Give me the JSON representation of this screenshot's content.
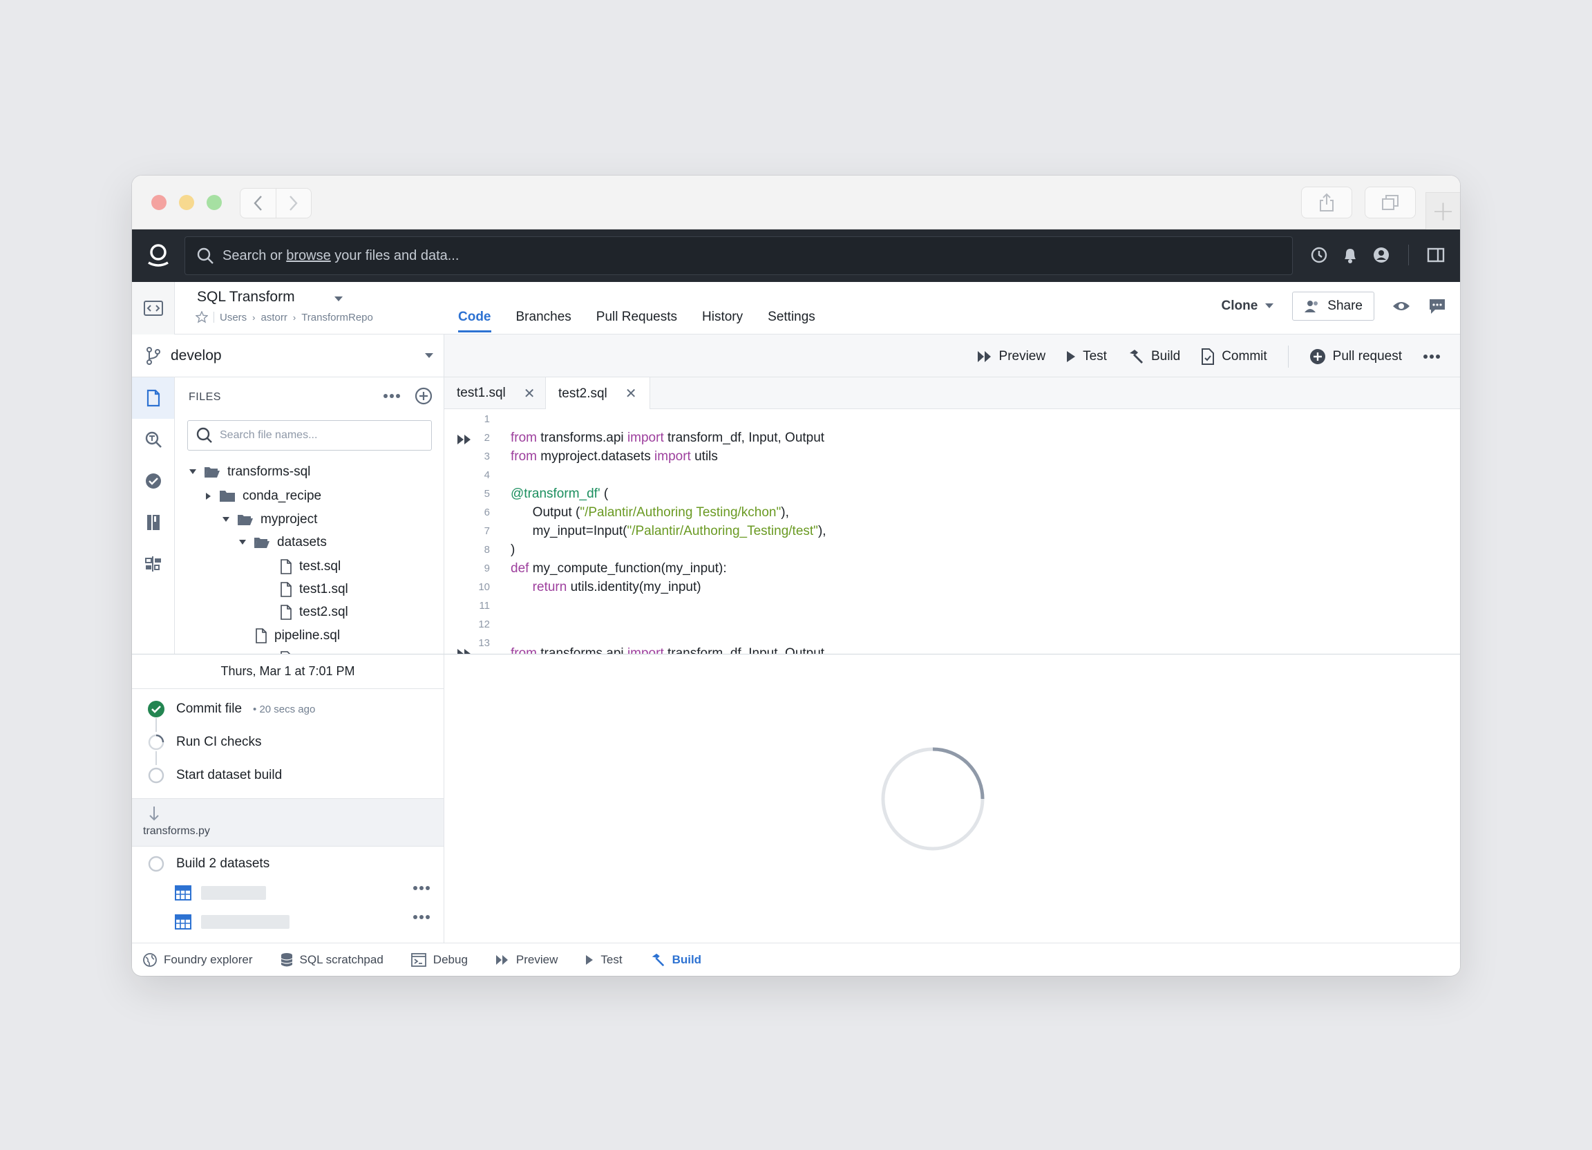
{
  "omnibar": {
    "search_prefix": "Search or ",
    "search_link": "browse",
    "search_suffix": " your files and data..."
  },
  "repo": {
    "title": "SQL Transform",
    "breadcrumb": [
      "Users",
      "astorr",
      "TransformRepo"
    ],
    "tabs": [
      {
        "label": "Code",
        "active": true
      },
      {
        "label": "Branches",
        "active": false
      },
      {
        "label": "Pull Requests",
        "active": false
      },
      {
        "label": "History",
        "active": false
      },
      {
        "label": "Settings",
        "active": false
      }
    ],
    "clone_label": "Clone",
    "share_label": "Share"
  },
  "branch": {
    "name": "develop"
  },
  "files": {
    "heading": "FILES",
    "search_placeholder": "Search file names...",
    "tree": [
      {
        "label": "transforms-sql",
        "type": "folder-open"
      },
      {
        "label": "conda_recipe",
        "type": "folder-closed"
      },
      {
        "label": "myproject",
        "type": "folder-open"
      },
      {
        "label": "datasets",
        "type": "folder-open"
      },
      {
        "label": "test.sql",
        "type": "file"
      },
      {
        "label": "test1.sql",
        "type": "file"
      },
      {
        "label": "test2.sql",
        "type": "file"
      },
      {
        "label": "pipeline.sql",
        "type": "file"
      }
    ]
  },
  "toolbar": {
    "preview": "Preview",
    "test": "Test",
    "build": "Build",
    "commit": "Commit",
    "pull_request": "Pull request"
  },
  "editor_tabs": [
    {
      "label": "test1.sql",
      "active": false
    },
    {
      "label": "test2.sql",
      "active": true
    }
  ],
  "code": {
    "line_numbers": [
      "1",
      "2",
      "3",
      "4",
      "5",
      "6",
      "7",
      "8",
      "9",
      "10",
      "11",
      "12",
      "13"
    ],
    "l2": {
      "k1": "from",
      "t1": " transforms.api ",
      "k2": "import",
      "t2": " transform_df, Input, Output"
    },
    "l3": {
      "k1": "from",
      "t1": " myproject.datasets ",
      "k2": "import",
      "t2": " utils"
    },
    "l5": {
      "d": "@transform_df'",
      "t": " ("
    },
    "l6": {
      "t1": "      Output (",
      "s": "\"/Palantir/Authoring Testing/kchon\"",
      "t2": "),"
    },
    "l7": {
      "t1": "      my_input=Input(",
      "s": "\"/Palantir/Authoring_Testing/test\"",
      "t2": "),"
    },
    "l8": ")",
    "l9": {
      "k": "def",
      "t": " my_compute_function(my_input):"
    },
    "l10": {
      "k": "      return",
      "t": " utils.identity(my_input)"
    },
    "l14": {
      "k1": "from",
      "t1": " transforms.api ",
      "k2": "import",
      "t2": " transform_df, Input, Output"
    }
  },
  "activity": {
    "date": "Thurs, Mar 1 at 7:01 PM",
    "steps": [
      {
        "label": "Commit file",
        "meta": "20 secs ago",
        "status": "done"
      },
      {
        "label": "Run CI checks",
        "status": "running"
      },
      {
        "label": "Start dataset build",
        "status": "pending"
      }
    ],
    "file": "transforms.py",
    "build_label": "Build 2 datasets"
  },
  "bottom": {
    "items": [
      {
        "label": "Foundry explorer",
        "icon": "globe-icon"
      },
      {
        "label": "SQL scratchpad",
        "icon": "database-icon"
      },
      {
        "label": "Debug",
        "icon": "console-icon"
      },
      {
        "label": "Preview",
        "icon": "fast-forward-icon"
      },
      {
        "label": "Test",
        "icon": "play-icon"
      },
      {
        "label": "Build",
        "icon": "hammer-icon",
        "active": true
      }
    ]
  },
  "colors": {
    "accent": "#2d72d2",
    "success": "#238551",
    "dark_header": "#252a31"
  }
}
